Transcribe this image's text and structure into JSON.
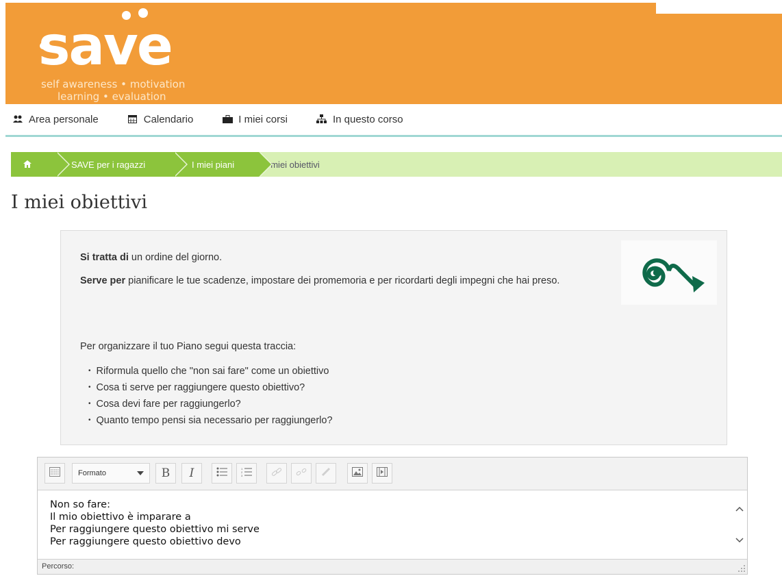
{
  "header": {
    "logo_word": "save",
    "tagline_line1": "self awareness • motivation",
    "tagline_line2": "learning • evaluation",
    "brand_color": "#f29c38"
  },
  "nav": {
    "items": [
      {
        "label": "Area personale",
        "icon": "users-icon"
      },
      {
        "label": "Calendario",
        "icon": "calendar-icon"
      },
      {
        "label": "I miei corsi",
        "icon": "briefcase-icon"
      },
      {
        "label": "In questo corso",
        "icon": "sitemap-icon"
      }
    ]
  },
  "breadcrumb": {
    "home_icon": "home-icon",
    "items": [
      "SAVE per i ragazzi",
      "I miei piani",
      "I miei obiettivi"
    ]
  },
  "page": {
    "title": "I miei obiettivi"
  },
  "info": {
    "line1_bold": "Si tratta di",
    "line1_rest": " un ordine del giorno.",
    "line2_bold": "Serve per",
    "line2_rest": " pianificare le tue scadenze, impostare dei promemoria e per ricordarti degli impegni che hai preso.",
    "intro": "Per organizzare il tuo Piano segui questa traccia:",
    "steps": [
      "Riformula quello che \"non sai fare\" come un obiettivo",
      "Cosa ti serve per raggiungere questo obiettivo?",
      "Cosa devi fare per raggiungerlo?",
      "Quanto tempo pensi sia necessario per raggiungerlo?"
    ],
    "image_icon": "spiral-arrow-icon"
  },
  "editor": {
    "format_label": "Formato",
    "toolbar": [
      "toggle-toolbar",
      "bold",
      "italic",
      "bullet-list",
      "numbered-list",
      "link",
      "unlink",
      "anchor",
      "image",
      "media"
    ],
    "lines": [
      "Non so fare:",
      "Il mio obiettivo è imparare a",
      "Per raggiungere questo obiettivo mi serve",
      "Per raggiungere questo obiettivo devo"
    ],
    "status_label": "Percorso:"
  }
}
